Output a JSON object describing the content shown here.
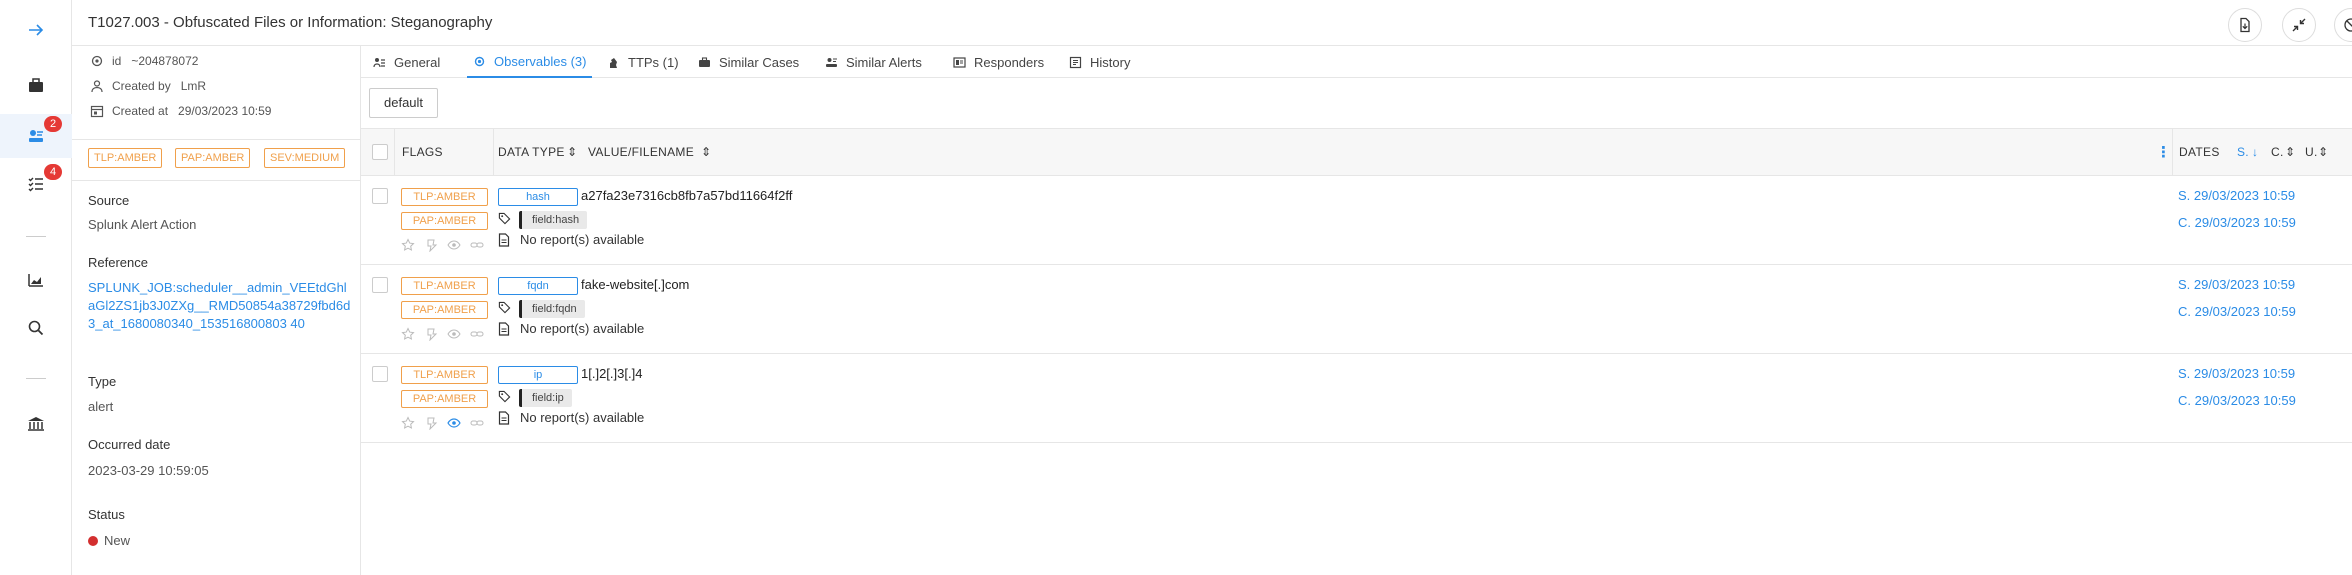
{
  "title": "T1027.003 - Obfuscated Files or Information: Steganography",
  "rail": {
    "badges": {
      "observables": "2",
      "tasks": "4"
    }
  },
  "side": {
    "id_label": "id",
    "id_value": "~204878072",
    "created_by_label": "Created by",
    "created_by_value": "LmR",
    "created_at_label": "Created at",
    "created_at_value": "29/03/2023 10:59",
    "pills": [
      "TLP:AMBER",
      "PAP:AMBER",
      "SEV:MEDIUM"
    ],
    "source_label": "Source",
    "source_value": "Splunk Alert Action",
    "reference_label": "Reference",
    "reference_value": "SPLUNK_JOB:scheduler__admin_VEEtdGhlaGl2ZS1jb3J0ZXg__RMD50854a38729fbd6d3_at_1680080340_153516800803 40",
    "type_label": "Type",
    "type_value": "alert",
    "occurred_label": "Occurred date",
    "occurred_value": "2023-03-29 10:59:05",
    "status_label": "Status",
    "status_value": "New"
  },
  "tabs": [
    "General",
    "Observables (3)",
    "TTPs (1)",
    "Similar Cases",
    "Similar Alerts",
    "Responders",
    "History"
  ],
  "default_button": "default",
  "table": {
    "headers": {
      "flags": "FLAGS",
      "data_type": "DATA TYPE",
      "value": "VALUE/FILENAME",
      "dates": "DATES",
      "s": "S.",
      "c": "C.",
      "u": "U."
    },
    "rows": [
      {
        "tlp": "TLP:AMBER",
        "pap": "PAP:AMBER",
        "data_type": "hash",
        "value": "a27fa23e7316cb8fb7a57bd11664f2ff",
        "tag": "field:hash",
        "report": "No report(s) available",
        "start": "S. 29/03/2023 10:59",
        "created": "C. 29/03/2023 10:59"
      },
      {
        "tlp": "TLP:AMBER",
        "pap": "PAP:AMBER",
        "data_type": "fqdn",
        "value": "fake-website[.]com",
        "tag": "field:fqdn",
        "report": "No report(s) available",
        "start": "S. 29/03/2023 10:59",
        "created": "C. 29/03/2023 10:59"
      },
      {
        "tlp": "TLP:AMBER",
        "pap": "PAP:AMBER",
        "data_type": "ip",
        "value": "1[.]2[.]3[.]4",
        "tag": "field:ip",
        "report": "No report(s) available",
        "start": "S. 29/03/2023 10:59",
        "created": "C. 29/03/2023 10:59"
      }
    ]
  },
  "colors": {
    "accent": "#2b8ce6",
    "amber": "#f0a04b",
    "badge": "#e53935"
  }
}
